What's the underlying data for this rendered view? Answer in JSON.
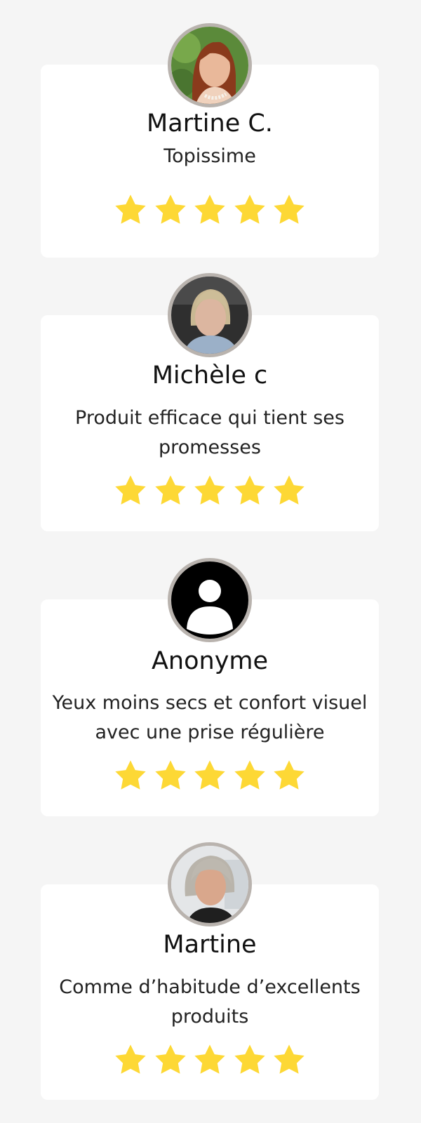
{
  "reviews": [
    {
      "name": "Martine C.",
      "text": "Topissime",
      "avatar_icon": "user-photo-woman-red-hair",
      "rating": 5
    },
    {
      "name": "Michèle c",
      "text": "Produit efficace qui tient ses promesses",
      "avatar_icon": "user-photo-woman-blonde",
      "rating": 5
    },
    {
      "name": "Anonyme",
      "text": "Yeux moins secs et confort visuel avec une prise régulière",
      "avatar_icon": "default-user-icon",
      "rating": 5
    },
    {
      "name": "Martine",
      "text": "Comme d’habitude d’excellents produits",
      "avatar_icon": "user-photo-woman-grey-hair",
      "rating": 5
    }
  ],
  "colors": {
    "background": "#f5f5f5",
    "card": "#ffffff",
    "star": "#fdd835",
    "avatar_border": "#b9b3ae"
  }
}
